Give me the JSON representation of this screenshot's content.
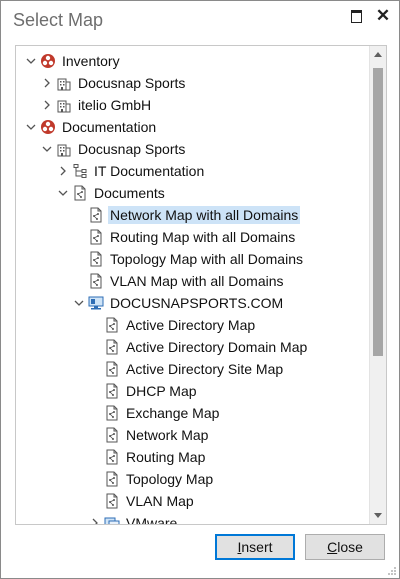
{
  "window": {
    "title": "Select Map"
  },
  "tree": {
    "rows": [
      {
        "label": "Inventory",
        "icon": "inventory-icon",
        "expander": "expanded"
      },
      {
        "label": "Docusnap Sports",
        "icon": "building-icon",
        "expander": "collapsed"
      },
      {
        "label": "itelio GmbH",
        "icon": "building-icon",
        "expander": "collapsed"
      },
      {
        "label": "Documentation",
        "icon": "documentation-icon",
        "expander": "expanded"
      },
      {
        "label": "Docusnap Sports",
        "icon": "building-icon",
        "expander": "expanded"
      },
      {
        "label": "IT Documentation",
        "icon": "hierarchy-icon",
        "expander": "collapsed"
      },
      {
        "label": "Documents",
        "icon": "map-document-icon",
        "expander": "expanded"
      },
      {
        "label": "Network Map with all Domains",
        "icon": "map-document-icon",
        "expander": "none",
        "selected": true
      },
      {
        "label": "Routing Map with all Domains",
        "icon": "map-document-icon",
        "expander": "none"
      },
      {
        "label": "Topology Map with all Domains",
        "icon": "map-document-icon",
        "expander": "none"
      },
      {
        "label": "VLAN Map with all Domains",
        "icon": "map-document-icon",
        "expander": "none"
      },
      {
        "label": "DOCUSNAPSPORTS.COM",
        "icon": "domain-computer-icon",
        "expander": "expanded"
      },
      {
        "label": "Active Directory Map",
        "icon": "map-document-icon",
        "expander": "none"
      },
      {
        "label": "Active Directory Domain Map",
        "icon": "map-document-icon",
        "expander": "none"
      },
      {
        "label": "Active Directory Site Map",
        "icon": "map-document-icon",
        "expander": "none"
      },
      {
        "label": "DHCP Map",
        "icon": "map-document-icon",
        "expander": "none"
      },
      {
        "label": "Exchange Map",
        "icon": "map-document-icon",
        "expander": "none"
      },
      {
        "label": "Network Map",
        "icon": "map-document-icon",
        "expander": "none"
      },
      {
        "label": "Routing Map",
        "icon": "map-document-icon",
        "expander": "none"
      },
      {
        "label": "Topology Map",
        "icon": "map-document-icon",
        "expander": "none"
      },
      {
        "label": "VLAN Map",
        "icon": "map-document-icon",
        "expander": "none"
      },
      {
        "label": "VMware",
        "icon": "vmware-icon",
        "expander": "collapsed"
      }
    ]
  },
  "buttons": {
    "insert_mnemonic": "I",
    "insert_rest": "nsert",
    "close_mnemonic": "C",
    "close_rest": "lose"
  },
  "colors": {
    "selection": "#cde3f7",
    "accent": "#0078d7",
    "scroll_thumb": "#a6a6a6"
  }
}
